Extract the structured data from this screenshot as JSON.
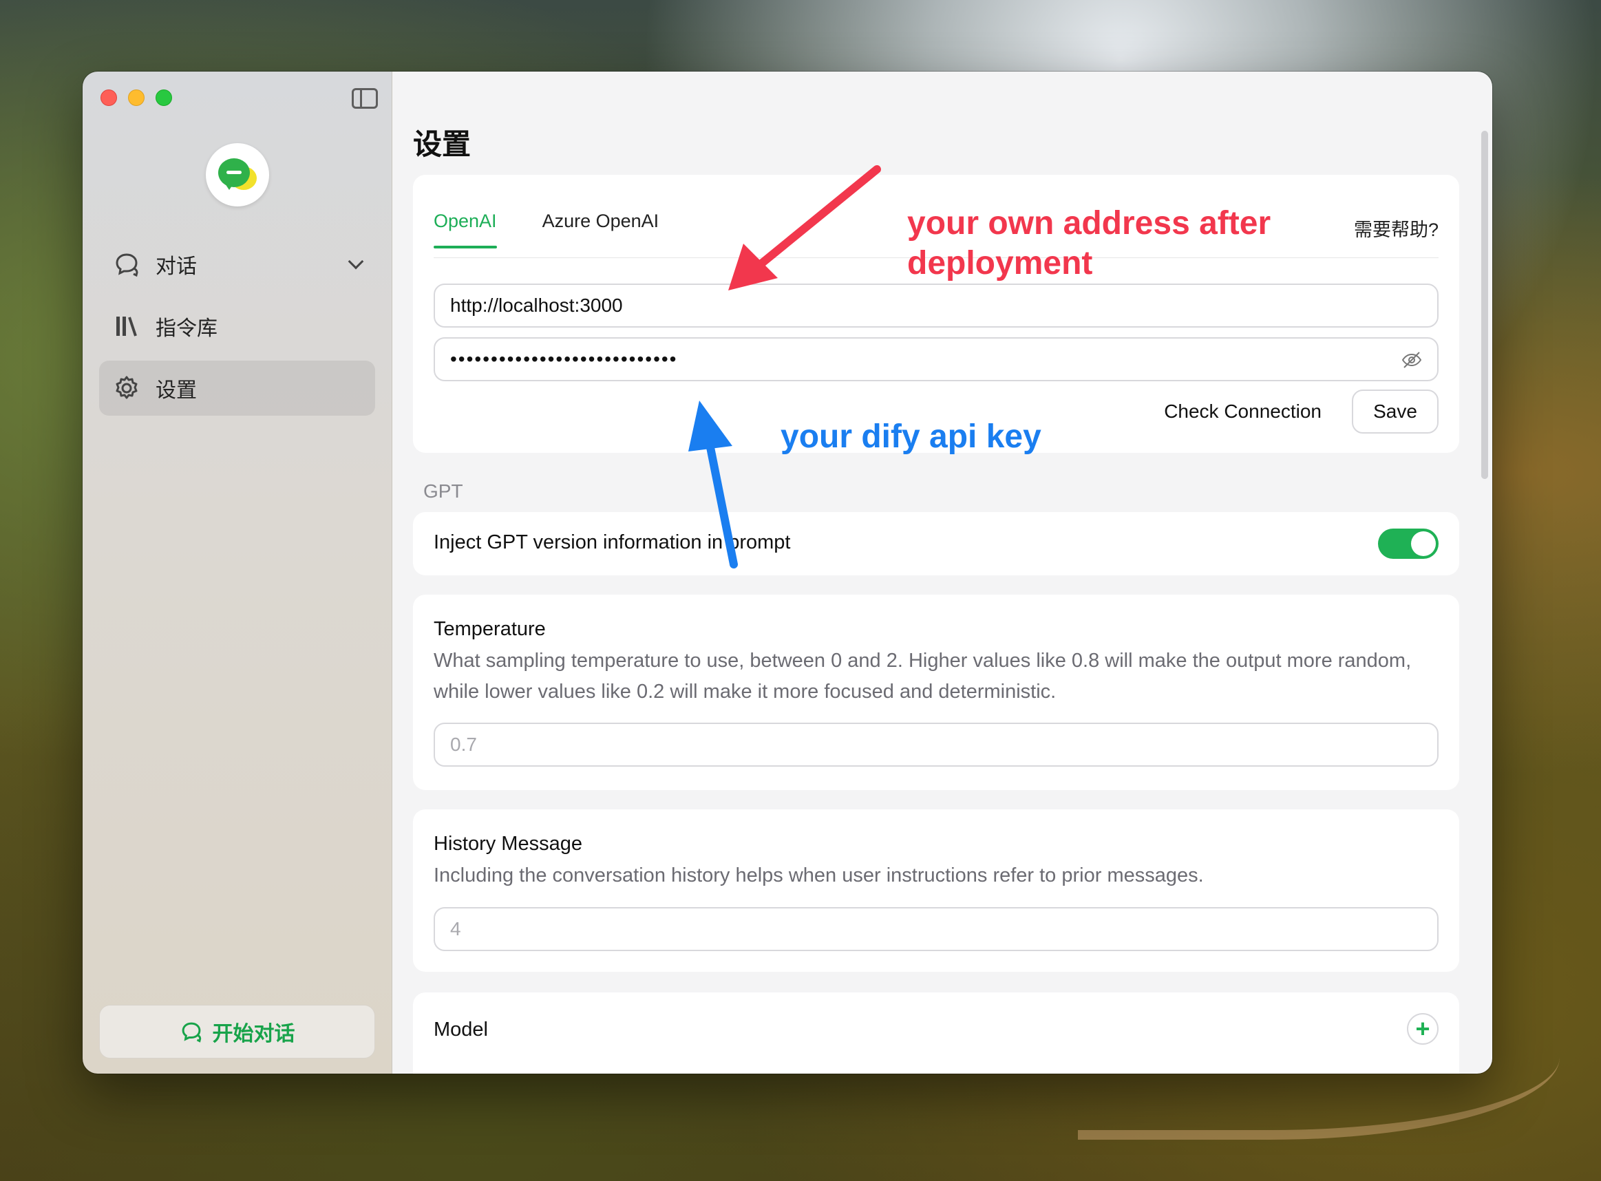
{
  "sidebar": {
    "items": [
      {
        "label": "对话",
        "icon": "chat-bubbles-icon"
      },
      {
        "label": "指令库",
        "icon": "library-icon"
      },
      {
        "label": "设置",
        "icon": "gear-icon"
      }
    ],
    "start_button": "开始对话"
  },
  "page": {
    "title": "设置"
  },
  "api_card": {
    "tabs": [
      {
        "label": "OpenAI"
      },
      {
        "label": "Azure OpenAI"
      }
    ],
    "help": "需要帮助?",
    "url_value": "http://localhost:3000",
    "key_value": "••••••••••••••••••••••••••••",
    "check_label": "Check Connection",
    "save_label": "Save"
  },
  "gpt_section": {
    "label": "GPT",
    "inject_title": "Inject GPT version information in prompt",
    "inject_enabled": true
  },
  "temperature": {
    "title": "Temperature",
    "desc": "What sampling temperature to use, between 0 and 2. Higher values like 0.8 will make the output more random, while lower values like 0.2 will make it more focused and deterministic.",
    "placeholder": "0.7"
  },
  "history": {
    "title": "History Message",
    "desc": "Including the conversation history helps when user instructions refer to prior messages.",
    "placeholder": "4"
  },
  "model": {
    "title": "Model",
    "add": "+"
  },
  "annotations": {
    "red": "your own address after deployment",
    "blue": "your dify api key"
  },
  "colors": {
    "accent": "#1dae57",
    "annotation_red": "#f2374d",
    "annotation_blue": "#1a7ef0"
  }
}
